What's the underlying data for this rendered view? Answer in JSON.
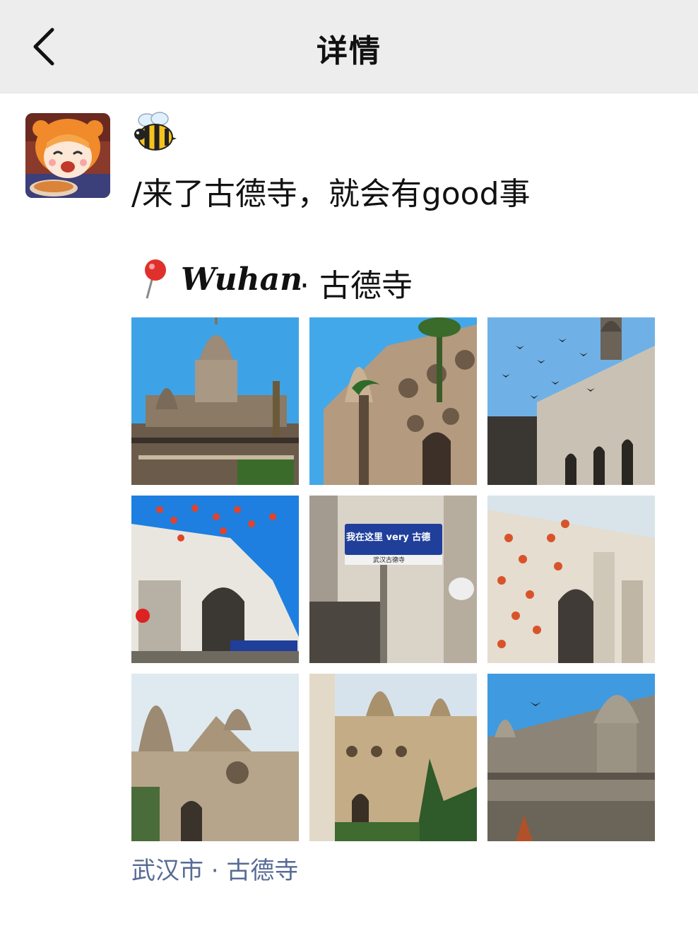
{
  "nav": {
    "title": "详情",
    "back_icon": "chevron-left-icon"
  },
  "post": {
    "avatar_icon": "anime-girl-avatar",
    "user_name_icon": "bee-emoji",
    "text": "/来了古德寺，就会有good事",
    "location_line": {
      "pin_icon": "round-pushpin-emoji",
      "city_stylized": "Wuhan",
      "separator_place": "· 古德寺"
    },
    "photos": [
      {
        "desc": "temple-dome-blue-sky",
        "sky": "#3ea3e6"
      },
      {
        "desc": "temple-facade-round-windows",
        "sky": "#43a8ea"
      },
      {
        "desc": "temple-birds-sky",
        "sky": "#6fb1e6"
      },
      {
        "desc": "arches-persimmon-tree",
        "sky": "#1e7fe0"
      },
      {
        "desc": "street-sign",
        "sign_text": "我在这里 very 古德",
        "sign_sub": "武汉古德寺"
      },
      {
        "desc": "persimmon-arches-white",
        "sky": "#d8e4ea"
      },
      {
        "desc": "temple-spires-facade",
        "sky": "#dfe9f0"
      },
      {
        "desc": "temple-courtyard-trees",
        "sky": "#d7e3ec"
      },
      {
        "desc": "temple-pigeons-dome",
        "sky": "#3f9ae0"
      }
    ],
    "location_link": "武汉市 · 古德寺"
  },
  "colors": {
    "nav_bg": "#ededed",
    "link": "#576b95"
  }
}
